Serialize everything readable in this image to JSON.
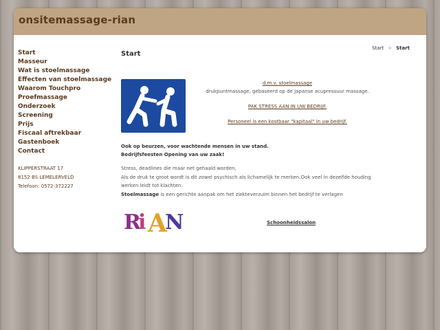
{
  "header": {
    "site_title": "onsitemassage-rian"
  },
  "colors": {
    "accent": "#bfa583",
    "text_brown": "#5b3a1e",
    "logo_blue": "#1c4aa0"
  },
  "nav": [
    "Start",
    "Masseur",
    "Wat is stoelmassage",
    "Effecten van stoelmassage",
    "Waarom Touchpro",
    "Proefmassage",
    "Onderzoek",
    "Screening",
    "Prijs",
    "Fiscaal aftrekbaar",
    "Gastenboek",
    "Contact"
  ],
  "address": {
    "street": "KLIPPERSTRAAT 17",
    "city": "8152 BS LEMELERVELD",
    "phone": "Telefoon: 0572-372227"
  },
  "main": {
    "page_title": "Start",
    "breadcrumb": {
      "home": "Start",
      "separator": ">",
      "current": "Start"
    },
    "logo_icon": "chair-massage-pictogram-icon",
    "link_stoelmassage": "d.m.v. stoelmassage",
    "text_drukpunt": "drukpuntmassage, gebaseerd op de Japanse acupressuur massage.",
    "link_stress": "PAK STRESS AAN IN UW BEDRIJF.",
    "link_personeel": "Personeel is een kostbaar \"kapitaal\" in uw bedrijf.",
    "events_line1": "Ook op beurzen, voor wachtende mensen in uw stand.",
    "events_line2": "Bedrijfsfeesten Opening van uw zaak!",
    "stress_line1": "Stress, deadlines die maar net gehaald worden,",
    "stress_line2": "Als de druk te groot wordt is dit zowel psychisch als lichamelijk te merken.Ook veel in dezelfde houding werken leidt tot klachten.",
    "stress_bold": "Stoelmassage",
    "stress_rest": " is een gerichte aanpak om het ziekteverzuim binnen het bedrijf te verlagen",
    "rian_logo_text": "RiAN",
    "schoonheidssalon": "Schoonheidssalon"
  }
}
